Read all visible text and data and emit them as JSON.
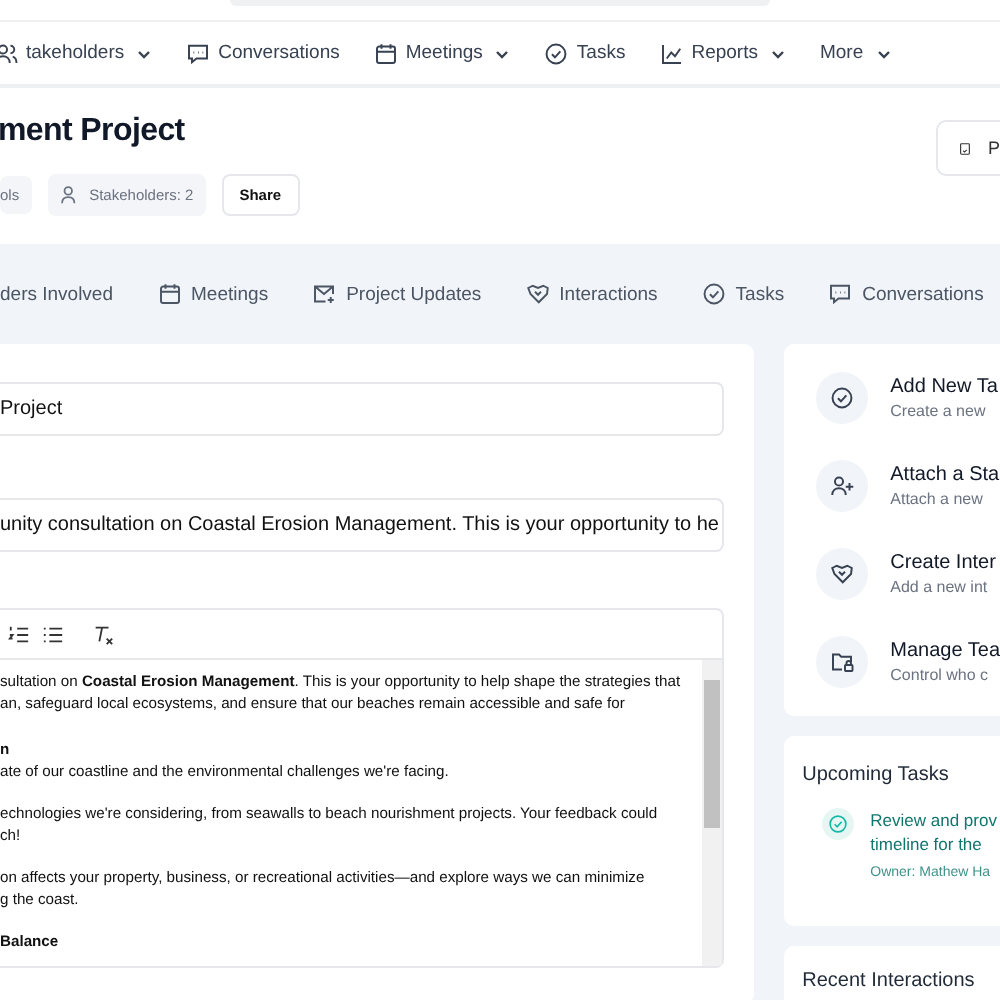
{
  "top_nav": {
    "items": [
      {
        "label": "takeholders",
        "kind": "users",
        "caret": true
      },
      {
        "label": "Conversations",
        "kind": "chat",
        "caret": false
      },
      {
        "label": "Meetings",
        "kind": "calendar",
        "caret": true
      },
      {
        "label": "Tasks",
        "kind": "check",
        "caret": false
      },
      {
        "label": "Reports",
        "kind": "chart",
        "caret": true
      },
      {
        "label": "More",
        "kind": "plain",
        "caret": true
      }
    ]
  },
  "header": {
    "title": "ment Project",
    "chips": [
      {
        "label": "ols",
        "kind": "plain"
      },
      {
        "label": "Stakeholders: 2",
        "kind": "user"
      }
    ],
    "share_button": "Share",
    "right_button": "P"
  },
  "tabs": [
    {
      "label": "ders Involved",
      "kind": "plain"
    },
    {
      "label": "Meetings",
      "kind": "calendar"
    },
    {
      "label": "Project Updates",
      "kind": "mail"
    },
    {
      "label": "Interactions",
      "kind": "handshake"
    },
    {
      "label": "Tasks",
      "kind": "check"
    },
    {
      "label": "Conversations",
      "kind": "chat"
    }
  ],
  "form": {
    "fields": [
      {
        "value": "Project"
      },
      {
        "value": "unity consultation on Coastal Erosion Management. This is your opportunity to he"
      }
    ],
    "editor": {
      "toolbar": [
        {
          "kind": "ordered-list"
        },
        {
          "kind": "bullet-list"
        },
        {
          "kind": "clear-format"
        }
      ],
      "blocks": [
        {
          "kind": "text",
          "lines": [
            "sultation on **Coastal Erosion Management**. This is your opportunity to help shape the strategies that",
            "an, safeguard local ecosystems, and ensure that our beaches remain accessible and safe for"
          ]
        },
        {
          "kind": "heading",
          "lines": [
            "n"
          ]
        },
        {
          "kind": "text",
          "lines": [
            "ate of our coastline and the environmental challenges we're facing."
          ]
        },
        {
          "kind": "text",
          "lines": [
            "echnologies we're considering, from seawalls to beach nourishment projects. Your feedback could",
            "ch!"
          ]
        },
        {
          "kind": "text",
          "lines": [
            "on affects your property, business, or recreational activities—and explore ways we can minimize",
            "g the coast."
          ]
        },
        {
          "kind": "heading",
          "lines": [
            "Balance"
          ]
        }
      ]
    }
  },
  "quick_actions": [
    {
      "title": "Add New Ta",
      "description": "Create a new",
      "kind": "check"
    },
    {
      "title": "Attach a Sta",
      "description": "Attach a new",
      "kind": "user-plus"
    },
    {
      "title": "Create Inter",
      "description": "Add a new int",
      "kind": "handshake"
    },
    {
      "title": "Manage Tea",
      "description": "Control who c",
      "kind": "folder-lock"
    }
  ],
  "upcoming_tasks": {
    "title": "Upcoming Tasks",
    "tasks": [
      {
        "lines": [
          "Review and prov",
          "timeline for the"
        ],
        "owner": "Owner: Mathew Ha"
      }
    ]
  },
  "recent_interactions": {
    "title": "Recent Interactions"
  }
}
